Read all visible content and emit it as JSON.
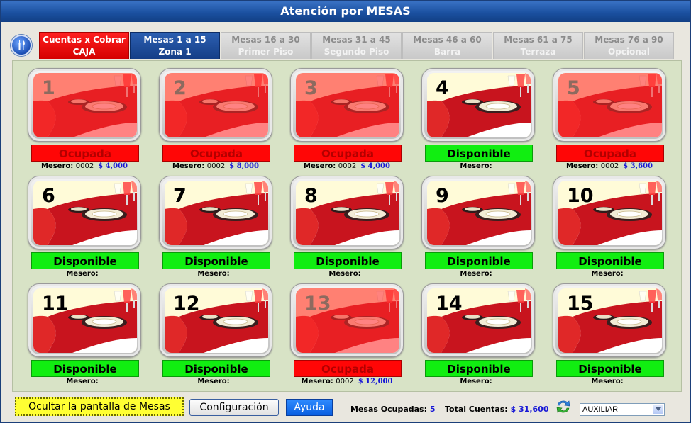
{
  "window": {
    "title": "Atención por MESAS"
  },
  "tabs": [
    {
      "line1": "Cuentas x Cobrar",
      "line2": "CAJA",
      "style": "red"
    },
    {
      "line1": "Mesas 1 a 15",
      "line2": "Zona 1",
      "style": "blue"
    },
    {
      "line1": "Mesas 16 a 30",
      "line2": "Primer Piso",
      "style": "gray"
    },
    {
      "line1": "Mesas 31 a 45",
      "line2": "Segundo Piso",
      "style": "gray"
    },
    {
      "line1": "Mesas 46 a 60",
      "line2": "Barra",
      "style": "gray"
    },
    {
      "line1": "Mesas 61 a 75",
      "line2": "Terraza",
      "style": "gray"
    },
    {
      "line1": "Mesas 76 a 90",
      "line2": "Opcional",
      "style": "gray"
    }
  ],
  "tables": [
    {
      "number": "1",
      "status": "Ocupada",
      "busy": true,
      "waiter_label": "Mesero:",
      "waiter_id": "0002",
      "amount": "$ 4,000"
    },
    {
      "number": "2",
      "status": "Ocupada",
      "busy": true,
      "waiter_label": "Mesero:",
      "waiter_id": "0002",
      "amount": "$ 8,000"
    },
    {
      "number": "3",
      "status": "Ocupada",
      "busy": true,
      "waiter_label": "Mesero:",
      "waiter_id": "0002",
      "amount": "$ 4,000"
    },
    {
      "number": "4",
      "status": "Disponible",
      "busy": false,
      "waiter_label": "Mesero:",
      "waiter_id": "",
      "amount": ""
    },
    {
      "number": "5",
      "status": "Ocupada",
      "busy": true,
      "waiter_label": "Mesero:",
      "waiter_id": "0002",
      "amount": "$ 3,600"
    },
    {
      "number": "6",
      "status": "Disponible",
      "busy": false,
      "waiter_label": "Mesero:",
      "waiter_id": "",
      "amount": ""
    },
    {
      "number": "7",
      "status": "Disponible",
      "busy": false,
      "waiter_label": "Mesero:",
      "waiter_id": "",
      "amount": ""
    },
    {
      "number": "8",
      "status": "Disponible",
      "busy": false,
      "waiter_label": "Mesero:",
      "waiter_id": "",
      "amount": ""
    },
    {
      "number": "9",
      "status": "Disponible",
      "busy": false,
      "waiter_label": "Mesero:",
      "waiter_id": "",
      "amount": ""
    },
    {
      "number": "10",
      "status": "Disponible",
      "busy": false,
      "waiter_label": "Mesero:",
      "waiter_id": "",
      "amount": ""
    },
    {
      "number": "11",
      "status": "Disponible",
      "busy": false,
      "waiter_label": "Mesero:",
      "waiter_id": "",
      "amount": ""
    },
    {
      "number": "12",
      "status": "Disponible",
      "busy": false,
      "waiter_label": "Mesero:",
      "waiter_id": "",
      "amount": ""
    },
    {
      "number": "13",
      "status": "Ocupada",
      "busy": true,
      "waiter_label": "Mesero:",
      "waiter_id": "0002",
      "amount": "$ 12,000"
    },
    {
      "number": "14",
      "status": "Disponible",
      "busy": false,
      "waiter_label": "Mesero:",
      "waiter_id": "",
      "amount": ""
    },
    {
      "number": "15",
      "status": "Disponible",
      "busy": false,
      "waiter_label": "Mesero:",
      "waiter_id": "",
      "amount": ""
    }
  ],
  "footer": {
    "hide_button": "Ocultar la pantalla de Mesas",
    "config_button": "Configuración",
    "help_button": "Ayuda",
    "occupied_label": "Mesas Ocupadas:",
    "occupied_value": "5",
    "total_label": "Total Cuentas:",
    "total_value": "$ 31,600",
    "user_select": "AUXILIAR"
  },
  "icons": {
    "menu": "fork-knife-icon",
    "refresh": "refresh-icon",
    "dropdown": "chevron-down-icon"
  },
  "colors": {
    "occupied": "#ff0606",
    "available": "#11ee11",
    "title_bar": "#1a4f9e",
    "panel": "#d8e3c6",
    "amount": "#1717d6"
  }
}
